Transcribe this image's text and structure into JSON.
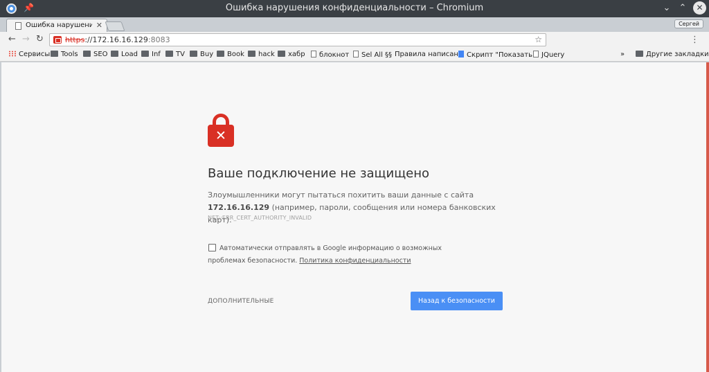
{
  "window": {
    "title": "Ошибка нарушения конфиденциальности – Chromium"
  },
  "tabs": [
    {
      "title": "Ошибка нарушения"
    }
  ],
  "profile": {
    "name": "Сергей"
  },
  "omnibox": {
    "scheme": "https",
    "sep": "://",
    "host": "172.16.16.129",
    "port": ":8083"
  },
  "bookmarks": [
    {
      "label": "Сервисы",
      "icon": "apps-grid-icon"
    },
    {
      "label": "Tools",
      "icon": "folder-icon"
    },
    {
      "label": "SEO",
      "icon": "folder-icon"
    },
    {
      "label": "Load",
      "icon": "folder-icon"
    },
    {
      "label": "Inf",
      "icon": "folder-icon"
    },
    {
      "label": "TV",
      "icon": "folder-icon"
    },
    {
      "label": "Buy",
      "icon": "folder-icon"
    },
    {
      "label": "Book",
      "icon": "folder-icon"
    },
    {
      "label": "hack",
      "icon": "folder-icon"
    },
    {
      "label": "хабр",
      "icon": "folder-icon"
    },
    {
      "label": "блокнот",
      "icon": "page-icon"
    },
    {
      "label": "Sel All",
      "icon": "page-icon"
    },
    {
      "label": "Правила написан",
      "icon": "section-sign-icon"
    },
    {
      "label": "Скрипт \"Показать",
      "icon": "google-doc-icon"
    },
    {
      "label": "JQuery",
      "icon": "page-icon"
    }
  ],
  "other_bookmarks": {
    "label": "Другие закладки",
    "chevron": "»"
  },
  "interstitial": {
    "heading": "Ваше подключение не защищено",
    "desc_prefix": "Злоумышленники могут пытаться похитить ваши данные с сайта ",
    "desc_host": "172.16.16.129",
    "desc_suffix": " (например, пароли, сообщения или номера банковских карт).",
    "error_code": "NET::ERR_CERT_AUTHORITY_INVALID",
    "optin_text": "Автоматически отправлять в Google информацию о возможных проблемах безопасности. ",
    "optin_link": "Политика конфиденциальности",
    "advanced_label": "ДОПОЛНИТЕЛЬНЫЕ",
    "back_button": "Назад к безопасности"
  },
  "colors": {
    "danger": "#d93025",
    "primary_button": "#4a8ff5"
  }
}
